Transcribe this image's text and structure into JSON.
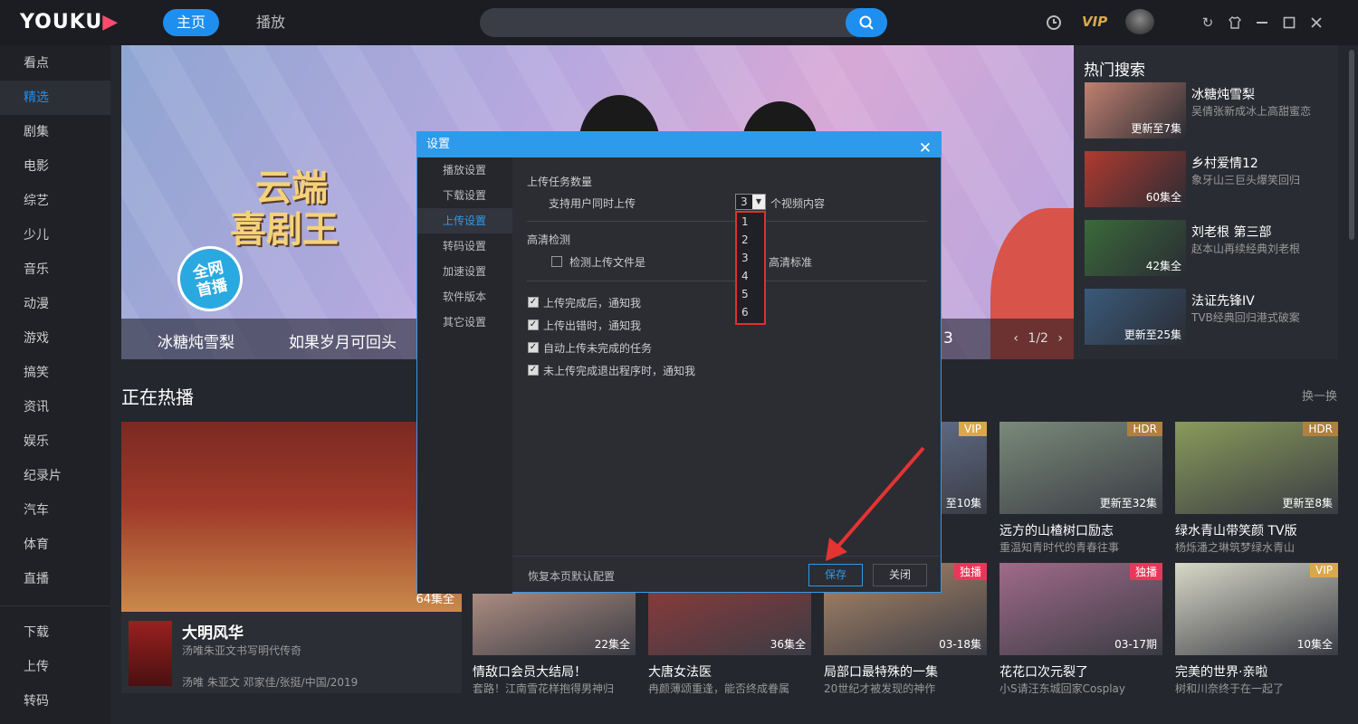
{
  "app": {
    "logo_text": "YOUKU",
    "nav": {
      "home": "主页",
      "play": "播放"
    },
    "vip": "VIP"
  },
  "sidebar": {
    "items": [
      "看点",
      "精选",
      "剧集",
      "电影",
      "综艺",
      "少儿",
      "音乐",
      "动漫",
      "游戏",
      "搞笑",
      "资讯",
      "娱乐",
      "纪录片",
      "汽车",
      "体育",
      "直播"
    ],
    "active_index": 1,
    "bottom_items": [
      "下载",
      "上传",
      "转码"
    ]
  },
  "banner": {
    "show_title_line1": "云端",
    "show_title_line2": "喜剧王",
    "badge_line1": "全网",
    "badge_line2": "首播",
    "strip_items": [
      "冰糖炖雪梨",
      "如果岁月可回头"
    ],
    "strip_partial": "3",
    "pager": "1/2"
  },
  "hot_search": {
    "title": "热门搜索",
    "items": [
      {
        "name": "冰糖炖雪梨",
        "desc": "吴倩张新成冰上高甜蜜恋",
        "caption": "更新至7集",
        "color": "#c08070"
      },
      {
        "name": "乡村爱情12",
        "desc": "象牙山三巨头爆笑回归",
        "caption": "60集全",
        "color": "#b03a30"
      },
      {
        "name": "刘老根 第三部",
        "desc": "赵本山再续经典刘老根",
        "caption": "42集全",
        "color": "#3a6a3a"
      },
      {
        "name": "法证先锋IV",
        "desc": "TVB经典回归港式破案",
        "caption": "更新至25集",
        "color": "#3a5a7a"
      }
    ]
  },
  "section": {
    "title": "正在热播",
    "swap": "换一换"
  },
  "featured": {
    "name": "大明风华",
    "desc": "汤唯朱亚文书写明代传奇",
    "meta": "汤唯 朱亚文 邓家佳/张挺/中国/2019",
    "caption": "64集全"
  },
  "cards_top": [
    {
      "name": "",
      "desc": "",
      "caption": "至10集",
      "tag": "VIP",
      "tag_color": "#d9a84b",
      "color": "#6a7a9a"
    },
    {
      "name": "远方的山楂树口励志",
      "desc": "重温知青时代的青春往事",
      "caption": "更新至32集",
      "tag": "HDR",
      "tag_color": "#b08040",
      "color": "#7a8a7a"
    },
    {
      "name": "绿水青山带笑颜 TV版",
      "desc": "杨烁潘之琳筑梦绿水青山",
      "caption": "更新至8集",
      "tag": "HDR",
      "tag_color": "#b08040",
      "color": "#8a9a5a"
    }
  ],
  "cards_bottom": [
    {
      "name": "情敌口会员大结局！",
      "desc": "套路！江南雪花样抱得男神归",
      "caption": "22集全",
      "tag": "",
      "tag_color": "",
      "color": "#c8a090"
    },
    {
      "name": "大唐女法医",
      "desc": "冉颜薄颂重逢，能否终成眷属",
      "caption": "36集全",
      "tag": "",
      "tag_color": "",
      "color": "#9a3a3a"
    },
    {
      "name": "局部口最特殊的一集",
      "desc": "20世纪才被发现的神作",
      "caption": "03-18集",
      "tag": "独播",
      "tag_color": "#e8385a",
      "color": "#b08a6a"
    },
    {
      "name": "花花口次元裂了",
      "desc": "小S请汪东城回家Cosplay",
      "caption": "03-17期",
      "tag": "独播",
      "tag_color": "#e8385a",
      "color": "#a06a8a"
    },
    {
      "name": "完美的世界·亲啦",
      "desc": "树和川奈终于在一起了",
      "caption": "10集全",
      "tag": "VIP",
      "tag_color": "#d9a84b",
      "color": "#d8d8c8"
    }
  ],
  "dialog": {
    "title": "设置",
    "nav": [
      "播放设置",
      "下载设置",
      "上传设置",
      "转码设置",
      "加速设置",
      "软件版本",
      "其它设置"
    ],
    "active_nav": 2,
    "upload_group": "上传任务数量",
    "upload_prefix": "支持用户同时上传",
    "upload_value": "3",
    "upload_suffix": "个视频内容",
    "dropdown_options": [
      "1",
      "2",
      "3",
      "4",
      "5",
      "6"
    ],
    "hd_group": "高清检测",
    "hd_check_a": "检测上传文件是",
    "hd_check_b": "高清标准",
    "checks": [
      {
        "label": "上传完成后，通知我",
        "checked": true
      },
      {
        "label": "上传出错时，通知我",
        "checked": true
      },
      {
        "label": "自动上传未完成的任务",
        "checked": true
      },
      {
        "label": "未上传完成退出程序时，通知我",
        "checked": true
      }
    ],
    "restore": "恢复本页默认配置",
    "save": "保存",
    "close": "关闭"
  }
}
